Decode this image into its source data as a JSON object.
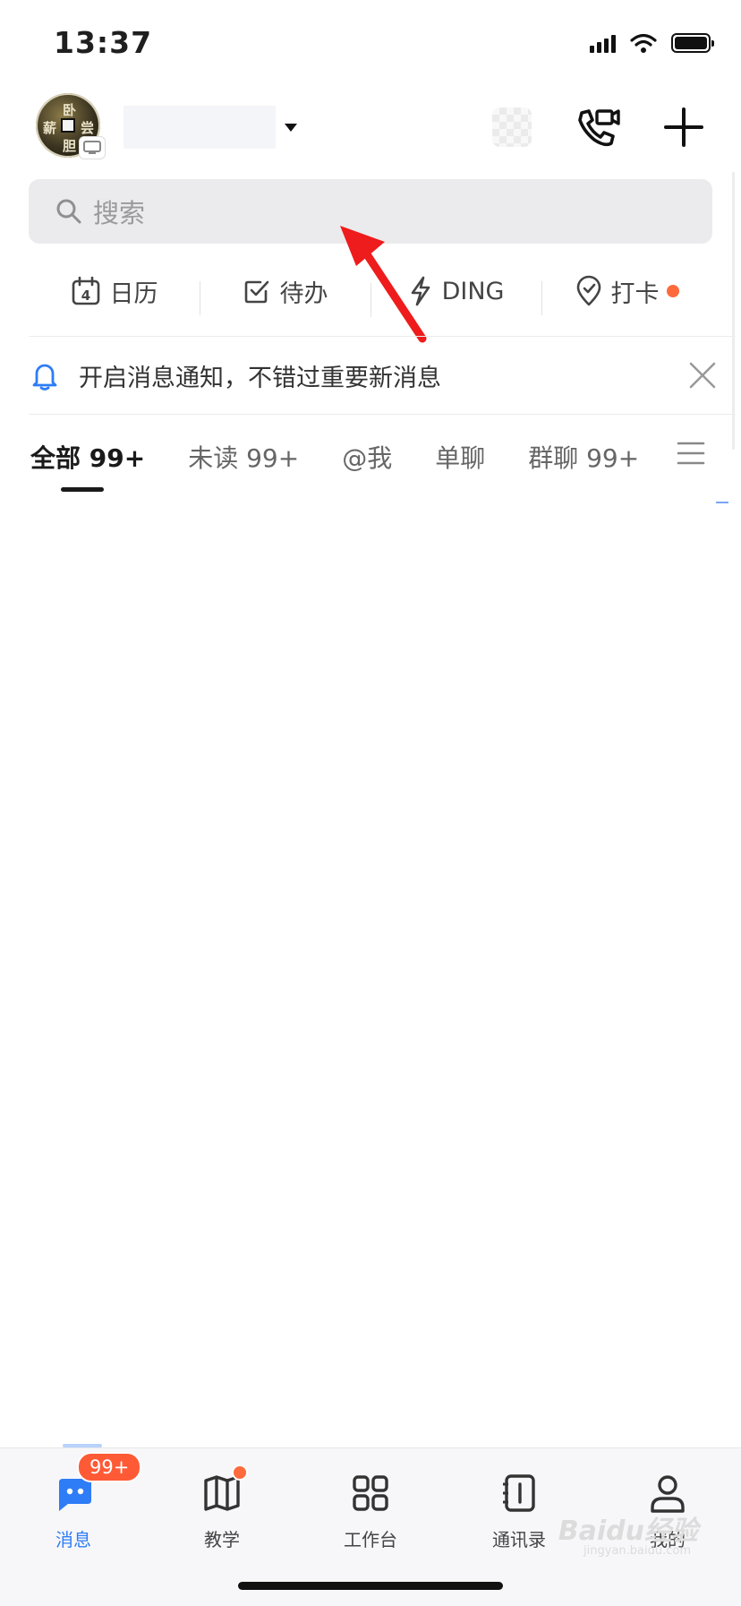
{
  "status_bar": {
    "time": "13:37"
  },
  "header": {
    "avatar_text": [
      "卧",
      "薪",
      "尝",
      "胆"
    ]
  },
  "search": {
    "placeholder": "搜索"
  },
  "quick_actions": [
    {
      "label": "日历",
      "icon": "calendar-icon",
      "date": "4"
    },
    {
      "label": "待办",
      "icon": "checkbox-icon"
    },
    {
      "label": "DING",
      "icon": "lightning-icon"
    },
    {
      "label": "打卡",
      "icon": "location-pin-icon"
    }
  ],
  "notice": {
    "text": "开启消息通知，不错过重要新消息"
  },
  "tabs": [
    {
      "label": "全部 99+"
    },
    {
      "label": "未读 99+"
    },
    {
      "label": "@我"
    },
    {
      "label": "单聊"
    },
    {
      "label": "群聊 99+"
    }
  ],
  "bottom_nav": {
    "badge": "99+",
    "items": [
      {
        "label": "消息",
        "icon": "chat-icon"
      },
      {
        "label": "教学",
        "icon": "book-icon"
      },
      {
        "label": "工作台",
        "icon": "grid-icon"
      },
      {
        "label": "通讯录",
        "icon": "contacts-icon"
      },
      {
        "label": "我的",
        "icon": "person-icon"
      }
    ]
  },
  "watermark": {
    "text": "Baidu经验",
    "sub": "jingyan.baidu.com"
  },
  "colors": {
    "accent": "#2e7cf6",
    "badge": "#ff5a36",
    "arrow": "#ee1c1c"
  }
}
